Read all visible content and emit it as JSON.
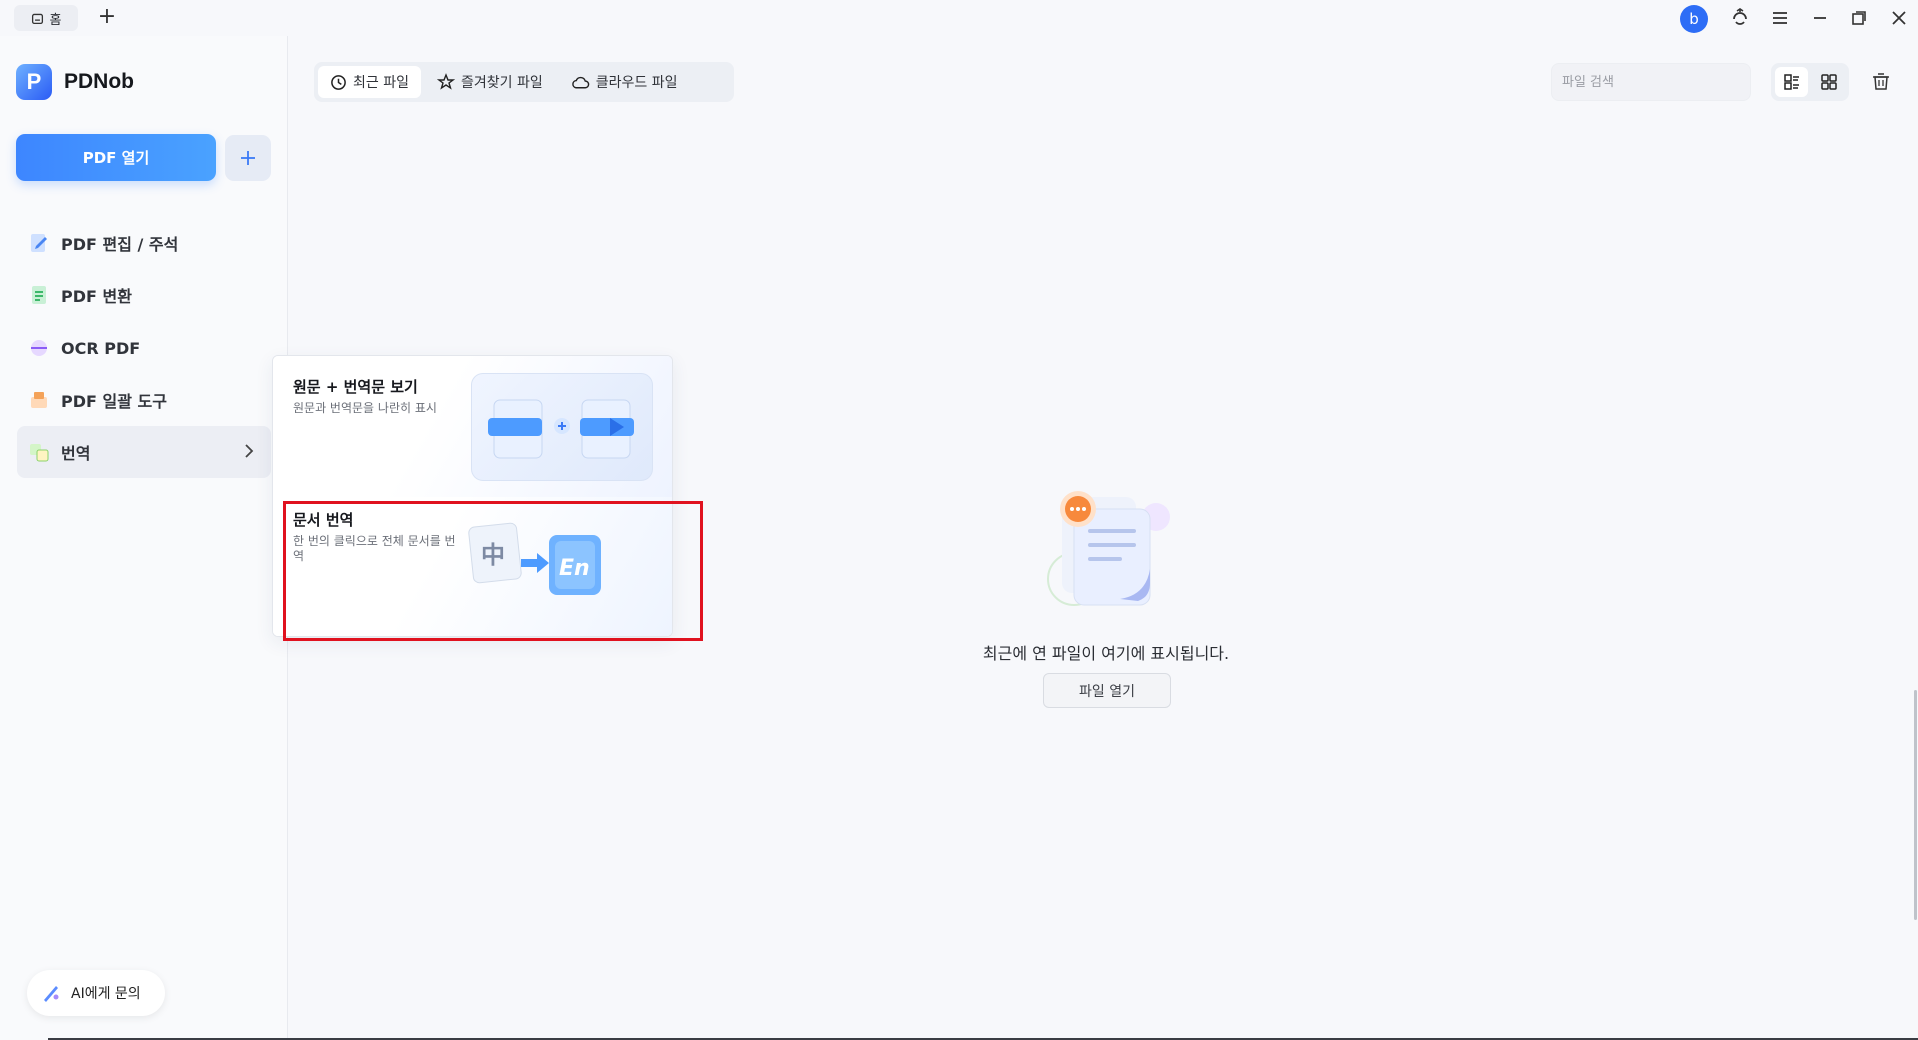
{
  "titlebar": {
    "home_tab_label": "홈",
    "avatar_letter": "b"
  },
  "sidebar": {
    "logo_letter": "P",
    "app_name": "PDNob",
    "open_pdf_label": "PDF 열기",
    "items": [
      {
        "label": "PDF 편집 / 주석",
        "icon": "edit-icon"
      },
      {
        "label": "PDF 변환",
        "icon": "convert-icon"
      },
      {
        "label": "OCR PDF",
        "icon": "ocr-icon"
      },
      {
        "label": "PDF 일괄 도구",
        "icon": "batch-icon"
      },
      {
        "label": "번역",
        "icon": "translate-icon"
      }
    ],
    "ai_button_label": "AI에게 문의"
  },
  "tabs": [
    {
      "label": "최근 파일",
      "icon": "clock-icon"
    },
    {
      "label": "즐겨찾기 파일",
      "icon": "star-icon"
    },
    {
      "label": "클라우드 파일",
      "icon": "cloud-icon"
    }
  ],
  "search": {
    "placeholder": "파일 검색"
  },
  "submenu": {
    "cards": [
      {
        "title": "원문 + 번역문 보기",
        "description": "원문과 번역문을 나란히 표시"
      },
      {
        "title": "문서 번역",
        "description": "한 번의 클릭으로 전체 문서를 번역"
      }
    ],
    "illus_glyph_source": "中",
    "illus_glyph_target": "En"
  },
  "empty_state": {
    "message": "최근에 연 파일이 여기에 표시됩니다.",
    "open_file_label": "파일 열기"
  },
  "colors": {
    "accent": "#3d86ff",
    "highlight": "#e0121f"
  }
}
